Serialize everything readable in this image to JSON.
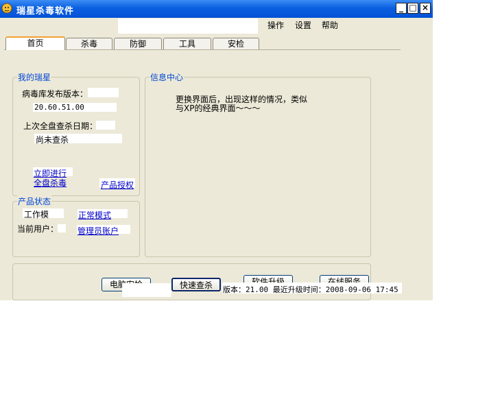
{
  "window": {
    "title": "瑞星杀毒软件",
    "minimize": "_",
    "maximize": "□",
    "close": "×"
  },
  "menu": [
    "操作",
    "设置",
    "帮助"
  ],
  "tabs": [
    "首页",
    "杀毒",
    "防御",
    "工具",
    "安检"
  ],
  "my_rising": {
    "title": "我的瑞星",
    "db_label": "病毒库发布版本：",
    "db_version": "20.60.51.00",
    "last_scan_label": "上次全盘查杀日期：",
    "last_scan_value": "尚未查杀",
    "scan_now_line1": "立即进行",
    "scan_now_line2": "全盘杀毒",
    "license_link": "产品授权"
  },
  "product_status": {
    "title": "产品状态",
    "mode_label": "工作模",
    "mode_value": "正常模式",
    "user_label": "当前用户：",
    "user_value": "管理员账户"
  },
  "info_center": {
    "title": "信息中心",
    "line1": "更换界面后，出现这样的情况，类似",
    "line2": "与XP的经典界面～～～"
  },
  "bottom": {
    "btn_checkup": "电脑安检",
    "btn_quick_scan": "快速查杀",
    "btn_upgrade": "软件升级",
    "btn_online": "在线服务",
    "status": "版本：21.00  最近升级时间：2008-09-06 17:45"
  },
  "colors": {
    "titlebar": "#0552d6",
    "face": "#ece9d8",
    "group_title": "#0046d5",
    "link": "#0000cc"
  }
}
